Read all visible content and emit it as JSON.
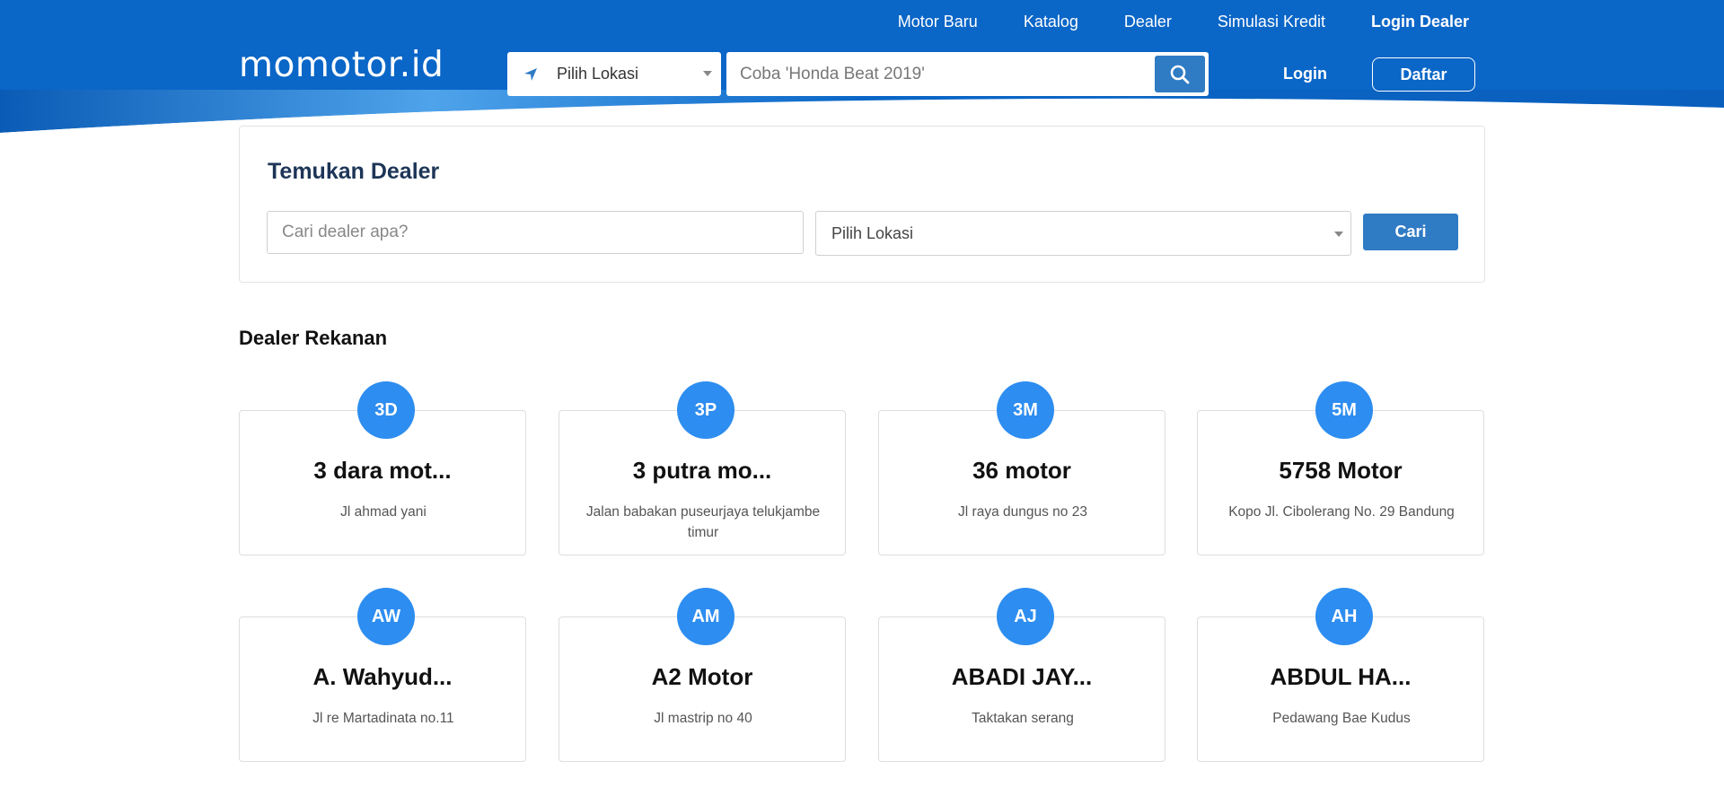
{
  "brand": {
    "logo_text": "momotor.id",
    "primary_color": "#0a66c7",
    "accent_color": "#2d8df0"
  },
  "topnav": {
    "items": [
      {
        "label": "Motor Baru"
      },
      {
        "label": "Katalog"
      },
      {
        "label": "Dealer"
      },
      {
        "label": "Simulasi Kredit"
      },
      {
        "label": "Login Dealer"
      }
    ]
  },
  "header": {
    "location_select": {
      "value": "Pilih Lokasi",
      "icon": "location-arrow-icon"
    },
    "search": {
      "placeholder": "Coba 'Honda Beat 2019'",
      "button_icon": "search-icon"
    },
    "login_label": "Login",
    "register_label": "Daftar"
  },
  "find_dealer": {
    "title": "Temukan Dealer",
    "search_placeholder": "Cari dealer apa?",
    "location_value": "Pilih Lokasi",
    "submit_label": "Cari"
  },
  "dealers": {
    "section_title": "Dealer Rekanan",
    "items": [
      {
        "initials": "3D",
        "name": "3 dara mot...",
        "address": "Jl ahmad yani"
      },
      {
        "initials": "3P",
        "name": "3 putra mo...",
        "address": "Jalan babakan puseurjaya telukjambe timur"
      },
      {
        "initials": "3M",
        "name": "36 motor",
        "address": "Jl raya dungus no 23"
      },
      {
        "initials": "5M",
        "name": "5758 Motor",
        "address": "Kopo Jl. Cibolerang No. 29 Bandung"
      },
      {
        "initials": "AW",
        "name": "A. Wahyud...",
        "address": "Jl re Martadinata no.11"
      },
      {
        "initials": "AM",
        "name": "A2 Motor",
        "address": "Jl mastrip no 40"
      },
      {
        "initials": "AJ",
        "name": "ABADI JAY...",
        "address": "Taktakan serang"
      },
      {
        "initials": "AH",
        "name": "ABDUL HA...",
        "address": "Pedawang Bae Kudus"
      }
    ]
  }
}
